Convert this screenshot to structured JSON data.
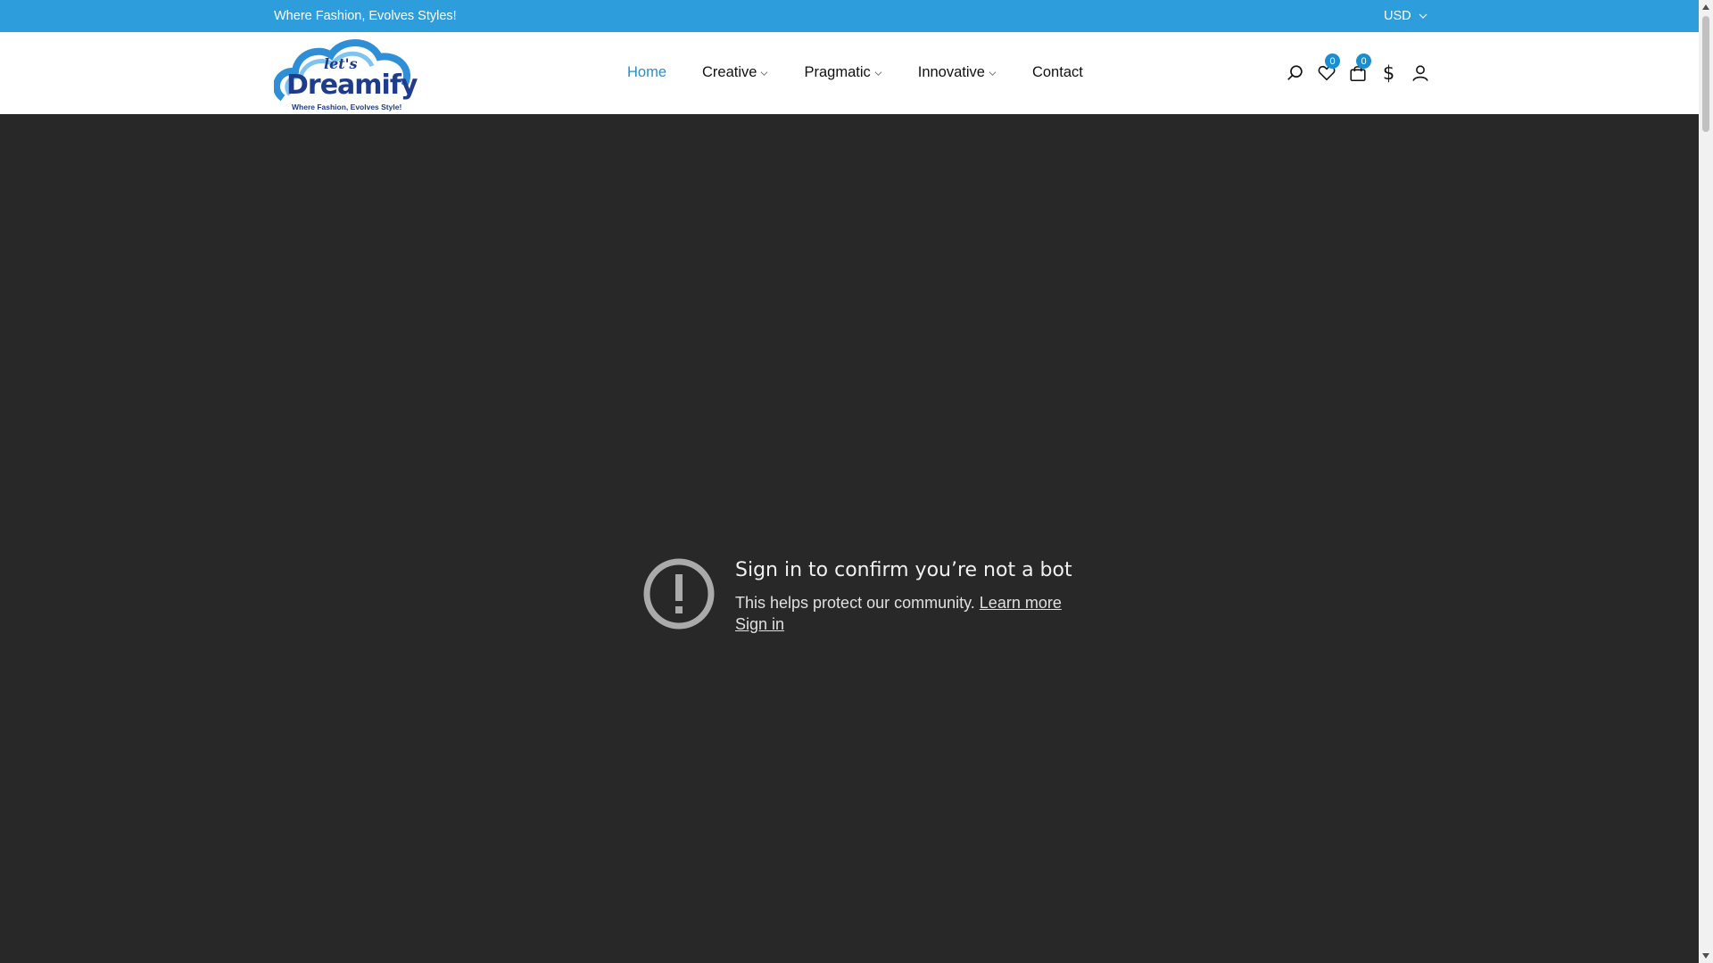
{
  "topbar": {
    "tagline": "Where Fashion, Evolves Styles!",
    "currency": "USD",
    "background": "#2e9ddc"
  },
  "logo": {
    "lets": "let's",
    "name": "Dreamify",
    "slogan": "Where Fashion, Evolves Style!"
  },
  "nav": {
    "items": [
      {
        "label": "Home",
        "active": true
      },
      {
        "label": "Creative",
        "dropdown": true
      },
      {
        "label": "Pragmatic",
        "dropdown": true
      },
      {
        "label": "Innovative",
        "dropdown": true
      },
      {
        "label": "Contact"
      }
    ],
    "active_color": "#2a8fc7"
  },
  "header_icons": {
    "search": "search-icon",
    "wishlist": {
      "icon": "heart-icon",
      "count": "0"
    },
    "cart": {
      "icon": "bag-icon",
      "count": "0"
    },
    "currency_symbol": "$",
    "account": "user-icon"
  },
  "embed": {
    "title": "Sign in to confirm you’re not a bot",
    "body": "This helps protect our community.",
    "learn_more": "Learn more",
    "sign_in": "Sign in"
  }
}
